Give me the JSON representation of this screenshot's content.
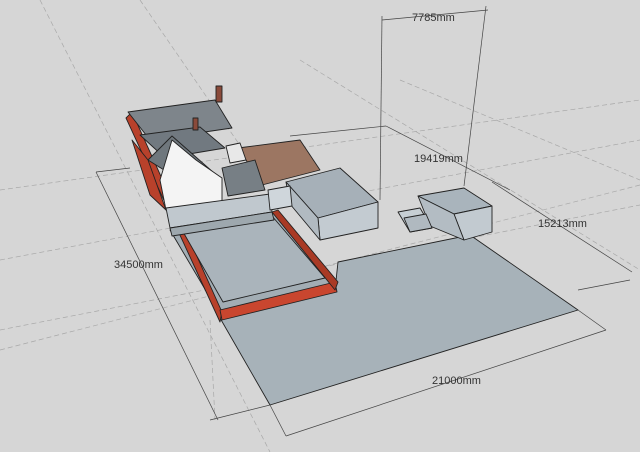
{
  "viewport": {
    "background": "#d6d6d6",
    "colors": {
      "ground": "#a9b4bb",
      "ground_dark": "#9aa5ac",
      "brick": "#c9462f",
      "brick_dark": "#9e3623",
      "roof_slate": "#7e858b",
      "wall_white": "#f4f4f4",
      "patio": "#9c7662",
      "shed_side": "#bfc8cf",
      "shed_top": "#a9b4bc"
    }
  },
  "dimensions": {
    "width_top": "7785mm",
    "diagonal": "19419mm",
    "depth_right": "15213mm",
    "depth_left": "34500mm",
    "width_bottom": "21000mm"
  }
}
